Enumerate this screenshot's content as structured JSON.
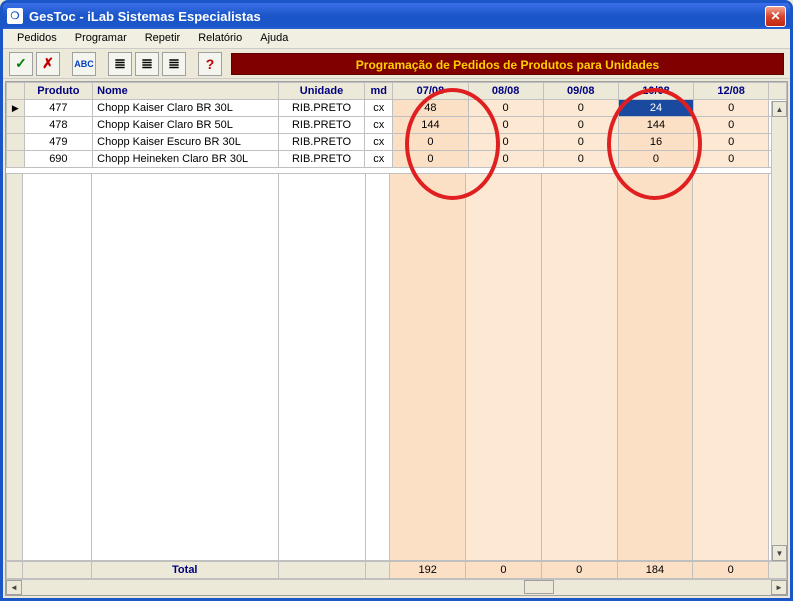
{
  "window": {
    "title": "GesToc - iLab Sistemas Especialistas"
  },
  "menu": {
    "pedidos": "Pedidos",
    "programar": "Programar",
    "repetir": "Repetir",
    "relatorio": "Relatório",
    "ajuda": "Ajuda"
  },
  "toolbar": {
    "confirm": "✓",
    "cancel": "✗",
    "abc": "ABC",
    "t4": "≣",
    "t5": "≣",
    "t6": "≣",
    "help": "?"
  },
  "banner": "Programação de Pedidos de Produtos para Unidades",
  "columns": {
    "produto": "Produto",
    "nome": "Nome",
    "unidade": "Unidade",
    "md": "md",
    "d1": "07/08",
    "d2": "08/08",
    "d3": "09/08",
    "d4": "10/08",
    "d5": "12/08"
  },
  "rows": [
    {
      "produto": "477",
      "nome": "Chopp Kaiser Claro BR 30L",
      "unidade": "RIB.PRETO",
      "md": "cx",
      "d1": "48",
      "d2": "0",
      "d3": "0",
      "d4": "24",
      "d5": "0"
    },
    {
      "produto": "478",
      "nome": "Chopp Kaiser Claro BR 50L",
      "unidade": "RIB.PRETO",
      "md": "cx",
      "d1": "144",
      "d2": "0",
      "d3": "0",
      "d4": "144",
      "d5": "0"
    },
    {
      "produto": "479",
      "nome": "Chopp Kaiser Escuro BR 30L",
      "unidade": "RIB.PRETO",
      "md": "cx",
      "d1": "0",
      "d2": "0",
      "d3": "0",
      "d4": "16",
      "d5": "0"
    },
    {
      "produto": "690",
      "nome": "Chopp Heineken Claro BR 30L",
      "unidade": "RIB.PRETO",
      "md": "cx",
      "d1": "0",
      "d2": "0",
      "d3": "0",
      "d4": "0",
      "d5": "0"
    }
  ],
  "totals": {
    "label": "Total",
    "d1": "192",
    "d2": "0",
    "d3": "0",
    "d4": "184",
    "d5": "0"
  },
  "selected": {
    "row": 0,
    "col": "d4"
  }
}
